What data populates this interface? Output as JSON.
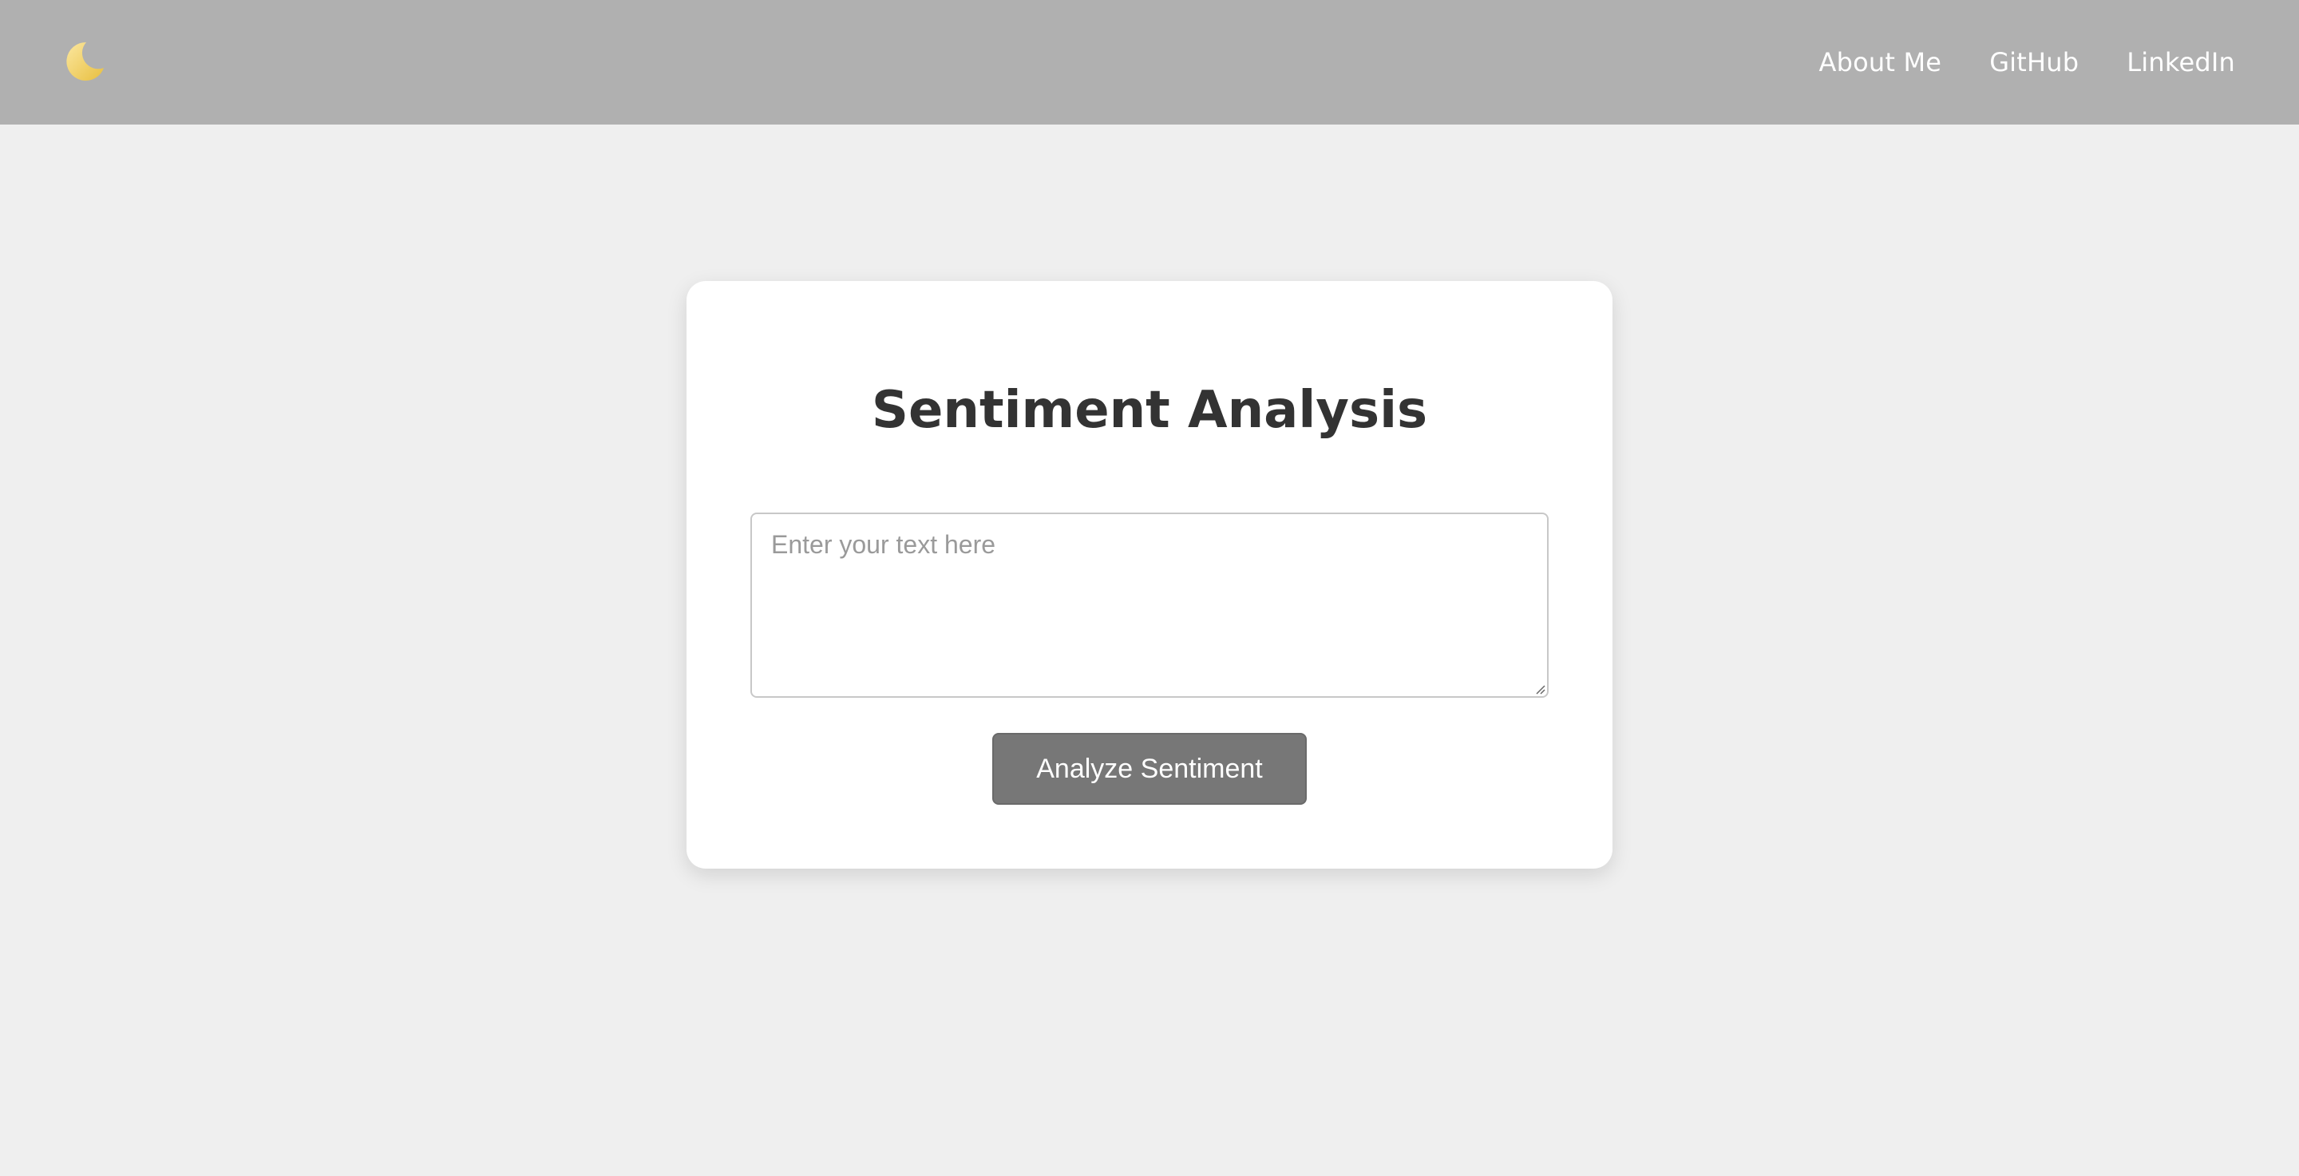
{
  "header": {
    "theme_toggle_icon": "crescent-moon-icon",
    "nav_links": [
      "About Me",
      "GitHub",
      "LinkedIn"
    ]
  },
  "main": {
    "title": "Sentiment Analysis",
    "input": {
      "value": "",
      "placeholder": "Enter your text here"
    },
    "analyze_button_label": "Analyze Sentiment"
  },
  "colors": {
    "header_bg": "#b0b0b0",
    "page_bg": "#efefef",
    "card_bg": "#ffffff",
    "title_text": "#333333",
    "button_bg": "#777777",
    "moon": "#f2d16b"
  }
}
